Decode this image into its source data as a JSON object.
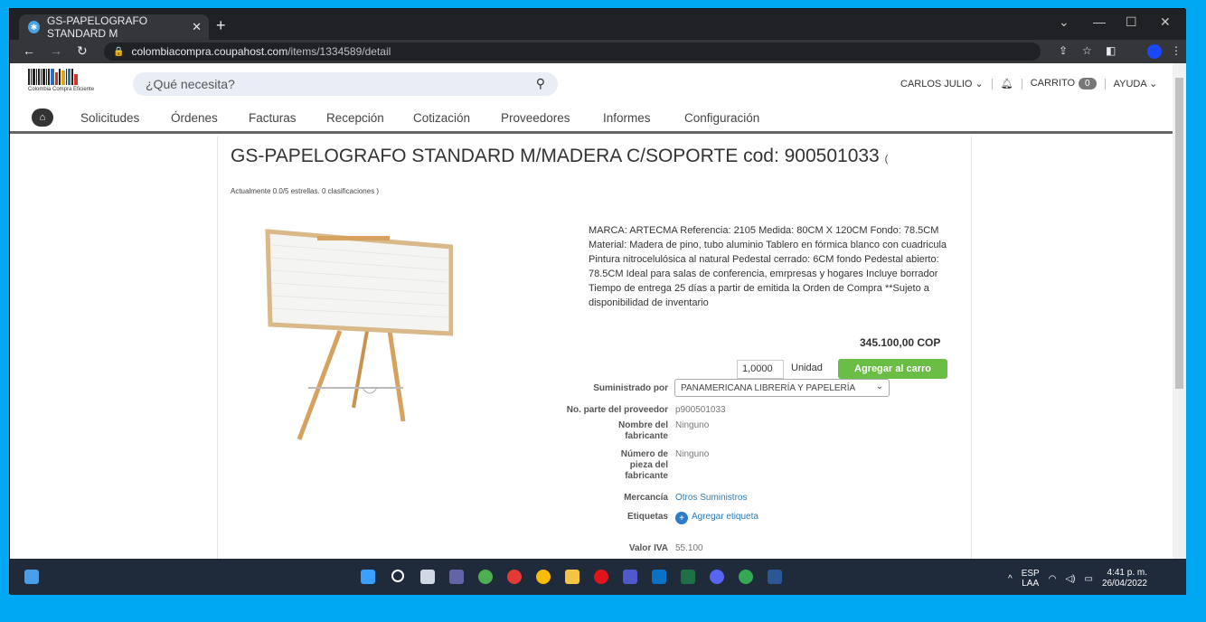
{
  "browser": {
    "tab_title": "GS-PAPELOGRAFO STANDARD M",
    "url_host": "colombiacompra.coupahost.com",
    "url_path": "/items/1334589/detail"
  },
  "header": {
    "logo_text": "Colombia Compra Eficiente",
    "search_placeholder": "¿Qué necesita?",
    "user_name": "CARLOS JULIO",
    "cart_label": "CARRITO",
    "cart_count": "0",
    "help_label": "AYUDA"
  },
  "nav": {
    "items": [
      "Solicitudes",
      "Órdenes",
      "Facturas",
      "Recepción",
      "Cotización",
      "Proveedores",
      "Informes",
      "Configuración"
    ]
  },
  "product": {
    "title": "GS-PAPELOGRAFO STANDARD M/MADERA C/SOPORTE cod: 900501033",
    "title_paren": "(",
    "rating": "Actualmente 0.0/5 estrellas. 0 clasificaciones )",
    "description": "MARCA: ARTECMA Referencia: 2105 Medida: 80CM X 120CM Fondo: 78.5CM Material: Madera de pino, tubo aluminio Tablero en fórmica blanco con cuadricula Pintura nitrocelulósica al natural Pedestal cerrado: 6CM fondo Pedestal abierto: 78.5CM Ideal para salas de conferencia, emrpresas y hogares Incluye borrador Tiempo de entrega 25 días a partir de emitida la Orden de Compra **Sujeto a disponibilidad de inventario",
    "price": "345.100,00 COP",
    "quantity": "1,0000",
    "unit": "Unidad",
    "add_to_cart": "Agregar al carro",
    "fields": {
      "supplier_label": "Suministrado por",
      "supplier_value": "PANAMERICANA LIBRERÍA Y PAPELERÍA",
      "part_label": "No. parte del proveedor",
      "part_value": "p900501033",
      "mfr_name_label": "Nombre del fabricante",
      "mfr_name_value": "Ninguno",
      "mfr_part_label": "Número de pieza del fabricante",
      "mfr_part_value": "Ninguno",
      "commodity_label": "Mercancía",
      "commodity_value": "Otros Suministros",
      "tags_label": "Etiquetas",
      "tags_value": "Agregar etiqueta",
      "iva_label": "Valor IVA",
      "iva_value": "55.100"
    }
  },
  "system": {
    "lang": "ESP",
    "layout": "LAA",
    "time": "4:41 p. m.",
    "date": "26/04/2022"
  },
  "colors": {
    "desktop": "#00a8f3",
    "button_green": "#6abe45",
    "link_blue": "#2a7ab8"
  }
}
